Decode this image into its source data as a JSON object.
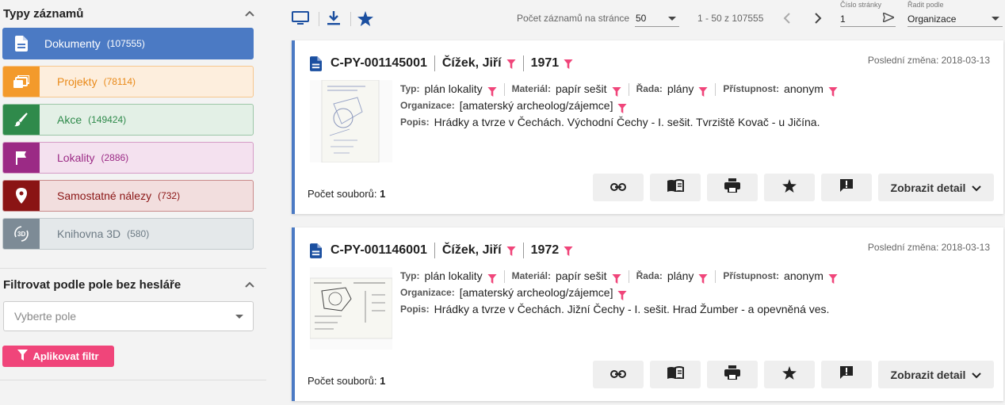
{
  "sidebar": {
    "title": "Typy záznamů",
    "types": [
      {
        "label": "Dokumenty",
        "count": "(107555)",
        "icon": "document-icon",
        "selected": true
      },
      {
        "label": "Projekty",
        "count": "(78114)",
        "icon": "projects-icon"
      },
      {
        "label": "Akce",
        "count": "(149424)",
        "icon": "brush-icon"
      },
      {
        "label": "Lokality",
        "count": "(2886)",
        "icon": "flag-icon"
      },
      {
        "label": "Samostatné nálezy",
        "count": "(732)",
        "icon": "location-pin-icon"
      },
      {
        "label": "Knihovna 3D",
        "count": "(580)",
        "icon": "rotate-3d-icon"
      }
    ],
    "filter_title": "Filtrovat podle pole bez hesláře",
    "filter_placeholder": "Vyberte pole",
    "apply_label": "Aplikovat filtr"
  },
  "toolbar": {
    "per_page_label": "Počet záznamů na stránce",
    "per_page_value": "50",
    "range": "1 - 50 z 107555",
    "page_label": "Číslo stránky",
    "page_value": "1",
    "sort_label": "Řadit podle",
    "sort_value": "Organizace"
  },
  "records": [
    {
      "id": "C-PY-001145001",
      "author": "Čížek, Jiří",
      "year": "1971",
      "modified": "Poslední změna: 2018-03-13",
      "typ_label": "Typ:",
      "typ": "plán lokality",
      "material_label": "Materiál:",
      "material": "papír sešit",
      "rada_label": "Řada:",
      "rada": "plány",
      "pristupnost_label": "Přístupnost:",
      "pristupnost": "anonym",
      "organizace_label": "Organizace:",
      "organizace": "[amaterský archeolog/zájemce]",
      "popis_label": "Popis:",
      "popis": "Hrádky a tvrze v Čechách. Východní Čechy - I. sešit. Tvrziště Kovač - u Jičína.",
      "files_label": "Počet souborů:",
      "files": "1",
      "detail_label": "Zobrazit detail"
    },
    {
      "id": "C-PY-001146001",
      "author": "Čížek, Jiří",
      "year": "1972",
      "modified": "Poslední změna: 2018-03-13",
      "typ_label": "Typ:",
      "typ": "plán lokality",
      "material_label": "Materiál:",
      "material": "papír sešit",
      "rada_label": "Řada:",
      "rada": "plány",
      "pristupnost_label": "Přístupnost:",
      "pristupnost": "anonym",
      "organizace_label": "Organizace:",
      "organizace": "[amaterský archeolog/zájemce]",
      "popis_label": "Popis:",
      "popis": "Hrádky a tvrze v Čechách. Jižní Čechy - I. sešit. Hrad Žumber - a opevněná ves.",
      "files_label": "Počet souborů:",
      "files": "1",
      "detail_label": "Zobrazit detail"
    }
  ],
  "colors": {
    "accent": "#1b4fa0",
    "pink": "#f0457a",
    "dokumenty": "#4b7ac4",
    "projekty": "#f39a2b",
    "akce": "#2f8a4b",
    "lokality": "#9b2a85",
    "nalezy": "#8a1414",
    "knihovna": "#7d8b96"
  }
}
